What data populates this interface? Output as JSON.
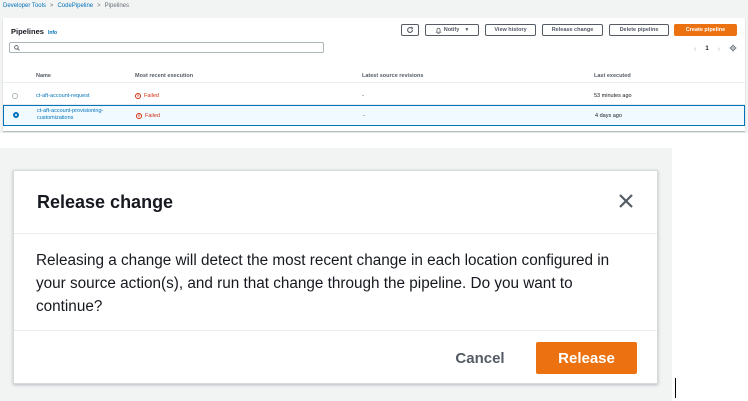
{
  "breadcrumb": [
    "Developer Tools",
    "CodePipeline",
    "Pipelines"
  ],
  "pipelines": {
    "title": "Pipelines",
    "info_label": "Info",
    "buttons": {
      "notify": "Notify",
      "view_history": "View history",
      "release_change": "Release change",
      "delete_pipeline": "Delete pipeline",
      "create_pipeline": "Create pipeline"
    },
    "search": {
      "value": "",
      "placeholder": ""
    },
    "pager": {
      "page": "1"
    },
    "columns": [
      "Name",
      "Most recent execution",
      "Latest source revisions",
      "Last executed"
    ],
    "rows": [
      {
        "name_line1": "ct-aft-account-request",
        "name_line2": "",
        "status": "Failed",
        "source": "-",
        "last_executed": "53 minutes ago",
        "selected": false
      },
      {
        "name_line1": "ct-aft-account-provisioning-",
        "name_line2": "customizations",
        "status": "Failed",
        "source": "-",
        "last_executed": "4 days ago",
        "selected": true
      }
    ]
  },
  "modal": {
    "title": "Release change",
    "body": "Releasing a change will detect the most recent change in each location configured in your source action(s), and run that change through the pipeline. Do you want to continue?",
    "cancel_label": "Cancel",
    "release_label": "Release"
  },
  "colors": {
    "accent": "#ec7211",
    "link": "#0073bb",
    "error": "#d13212"
  },
  "icons": [
    "refresh-icon",
    "bell-icon",
    "caret-down-icon",
    "search-icon",
    "chevron-left-icon",
    "chevron-right-icon",
    "settings-icon",
    "failed-icon",
    "close-icon"
  ]
}
